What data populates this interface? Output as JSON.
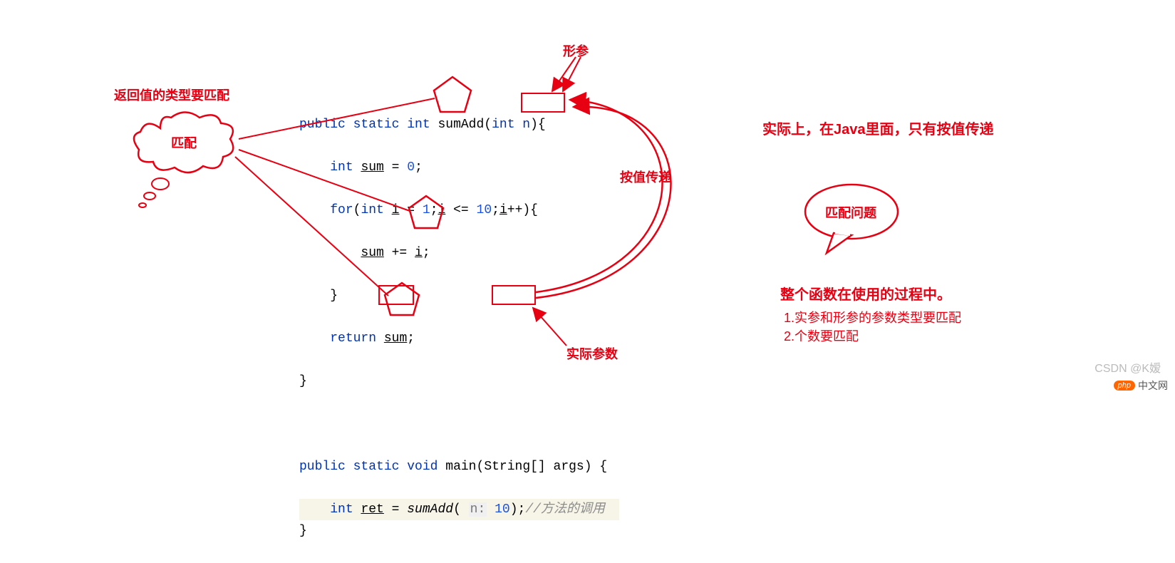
{
  "annotations": {
    "return_type_match": "返回值的类型要匹配",
    "match": "匹配",
    "formal_param": "形参",
    "pass_by_value": "按值传递",
    "actual_param": "实际参数",
    "fact_java": "实际上，在Java里面，只有按值传递",
    "match_problem": "匹配问题",
    "usage_line": "整个函数在使用的过程中。",
    "rule1": "1.实参和形参的参数类型要匹配",
    "rule2": "2.个数要匹配"
  },
  "code": {
    "sig_public": "public",
    "sig_static": "static",
    "sig_int": "int",
    "sig_name": "sumAdd",
    "sig_param": "int n",
    "l2_int": "int",
    "l2_sum": "sum",
    "l2_eq": " = ",
    "l2_zero": "0",
    "l3_for": "for",
    "l3_int": "int",
    "l3_i1": "i",
    "l3_eq1": " = ",
    "l3_one": "1",
    "l3_semi": ";",
    "l3_i2": "i",
    "l3_le": " <= ",
    "l3_ten": "10",
    "l3_i3": "i",
    "l3_pp": "++){",
    "l4_sum": "sum",
    "l4_pe": " += ",
    "l4_i": "i",
    "l6_return": "return",
    "l6_sum": "sum",
    "main_public": "public",
    "main_static": "static",
    "main_void": "void",
    "main_name": "main",
    "main_args": "String[] args",
    "call_int": "int",
    "call_ret": "ret",
    "call_eq": " = ",
    "call_fn": "sumAdd",
    "call_hint": "n:",
    "call_arg": "10",
    "call_comment": "//方法的调用"
  },
  "watermark": {
    "csdn": "CSDN @K嫒",
    "site": "中文网",
    "badge": "php"
  }
}
